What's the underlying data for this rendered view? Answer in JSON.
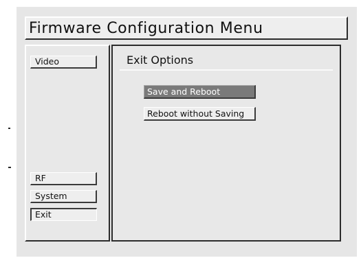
{
  "window": {
    "title": "Firmware Configuration Menu"
  },
  "sidebar": {
    "items": [
      {
        "label": "Video",
        "active": false
      },
      {
        "label": "RF",
        "active": false
      },
      {
        "label": "System",
        "active": false
      },
      {
        "label": "Exit",
        "active": true
      }
    ]
  },
  "content": {
    "section_title": "Exit Options",
    "buttons": {
      "save_reboot": "Save and Reboot",
      "reboot_no_save": "Reboot without Saving"
    }
  }
}
